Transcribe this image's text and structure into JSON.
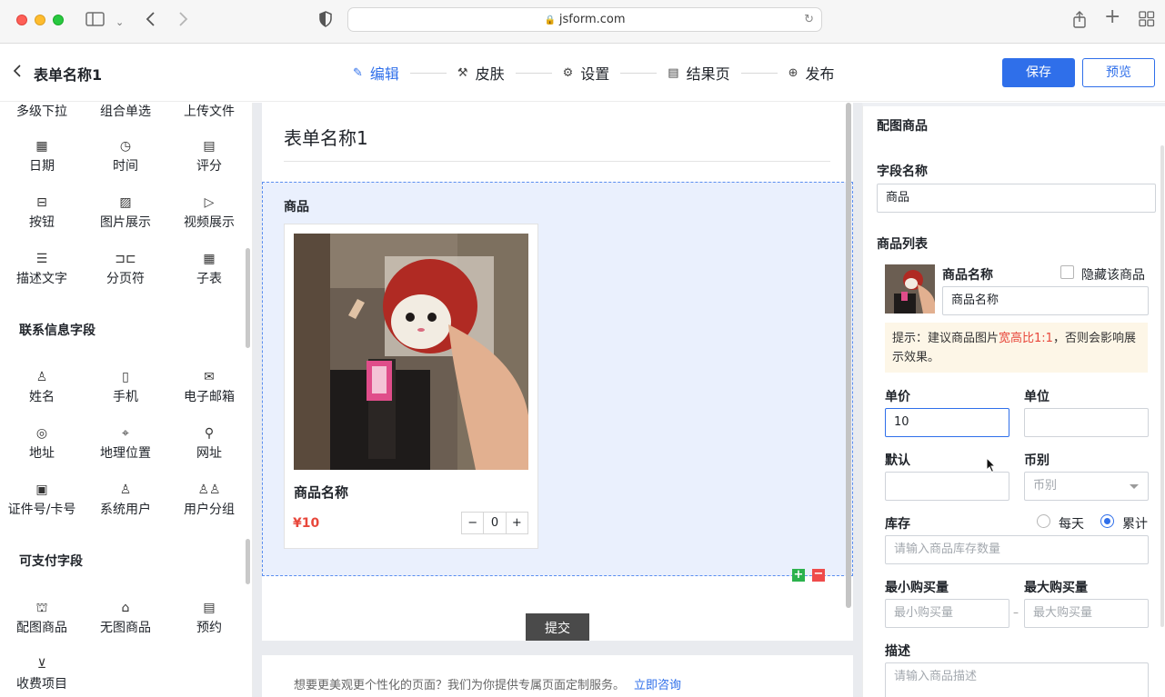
{
  "browser": {
    "url": "jsform.com"
  },
  "header": {
    "back_label": "<",
    "form_title": "表单名称1",
    "steps": [
      {
        "icon": "edit-icon",
        "label": "编辑"
      },
      {
        "icon": "skin-icon",
        "label": "皮肤"
      },
      {
        "icon": "gear-icon",
        "label": "设置"
      },
      {
        "icon": "result-page-icon",
        "label": "结果页"
      },
      {
        "icon": "publish-icon",
        "label": "发布"
      }
    ],
    "save_label": "保存",
    "preview_label": "预览"
  },
  "palette": {
    "row0": [
      "多级下拉",
      "组合单选",
      "上传文件"
    ],
    "basic": [
      {
        "icon": "calendar-icon",
        "label": "日期"
      },
      {
        "icon": "clock-icon",
        "label": "时间"
      },
      {
        "icon": "rating-icon",
        "label": "评分"
      },
      {
        "icon": "button-icon",
        "label": "按钮"
      },
      {
        "icon": "image-icon",
        "label": "图片展示"
      },
      {
        "icon": "video-icon",
        "label": "视频展示"
      },
      {
        "icon": "text-icon",
        "label": "描述文字"
      },
      {
        "icon": "page-break-icon",
        "label": "分页符"
      },
      {
        "icon": "table-icon",
        "label": "子表"
      }
    ],
    "contact_title": "联系信息字段",
    "contact": [
      {
        "icon": "user-icon",
        "label": "姓名"
      },
      {
        "icon": "phone-icon",
        "label": "手机"
      },
      {
        "icon": "mail-icon",
        "label": "电子邮箱"
      },
      {
        "icon": "address-icon",
        "label": "地址"
      },
      {
        "icon": "location-pin-icon",
        "label": "地理位置"
      },
      {
        "icon": "link-icon",
        "label": "网址"
      },
      {
        "icon": "id-card-icon",
        "label": "证件号/卡号"
      },
      {
        "icon": "system-user-icon",
        "label": "系统用户"
      },
      {
        "icon": "user-group-icon",
        "label": "用户分组"
      }
    ],
    "pay_title": "可支付字段",
    "pay": [
      {
        "icon": "product-image-icon",
        "label": "配图商品"
      },
      {
        "icon": "product-bag-icon",
        "label": "无图商品"
      },
      {
        "icon": "booking-icon",
        "label": "预约"
      },
      {
        "icon": "fee-icon",
        "label": "收费项目"
      }
    ]
  },
  "canvas": {
    "form_title": "表单名称1",
    "field_label": "商品",
    "product_name": "商品名称",
    "product_price": "¥10",
    "qty_minus": "−",
    "qty_value": "0",
    "qty_plus": "+",
    "submit_label": "提交",
    "promo_text": "想要更美观更个性化的页面？我们为你提供专属页面定制服务。",
    "promo_link": "立即咨询"
  },
  "settings": {
    "section_title": "配图商品",
    "field_name_label": "字段名称",
    "field_name_value": "商品",
    "list_label": "商品列表",
    "item_name_label": "商品名称",
    "hide_item_label": "隐藏该商品",
    "item_name_value": "商品名称",
    "tip_prefix": "提示：建议商品图片",
    "tip_highlight": "宽高比1:1",
    "tip_suffix": "，否则会影响展示效果。",
    "price_label": "单价",
    "price_value": "10",
    "unit_label": "单位",
    "unit_value": "",
    "default_label": "默认",
    "default_value": "",
    "currency_label": "币别",
    "currency_placeholder": "币别",
    "stock_label": "库存",
    "stock_daily": "每天",
    "stock_total": "累计",
    "stock_placeholder": "请输入商品库存数量",
    "min_label": "最小购买量",
    "min_placeholder": "最小购买量",
    "max_label": "最大购买量",
    "max_placeholder": "最大购买量",
    "range_dash": "–",
    "desc_label": "描述",
    "desc_placeholder": "请输入商品描述"
  },
  "colors": {
    "accent": "#2f6fea",
    "price": "#e8473b",
    "tip_bg": "#fdf6e7"
  }
}
